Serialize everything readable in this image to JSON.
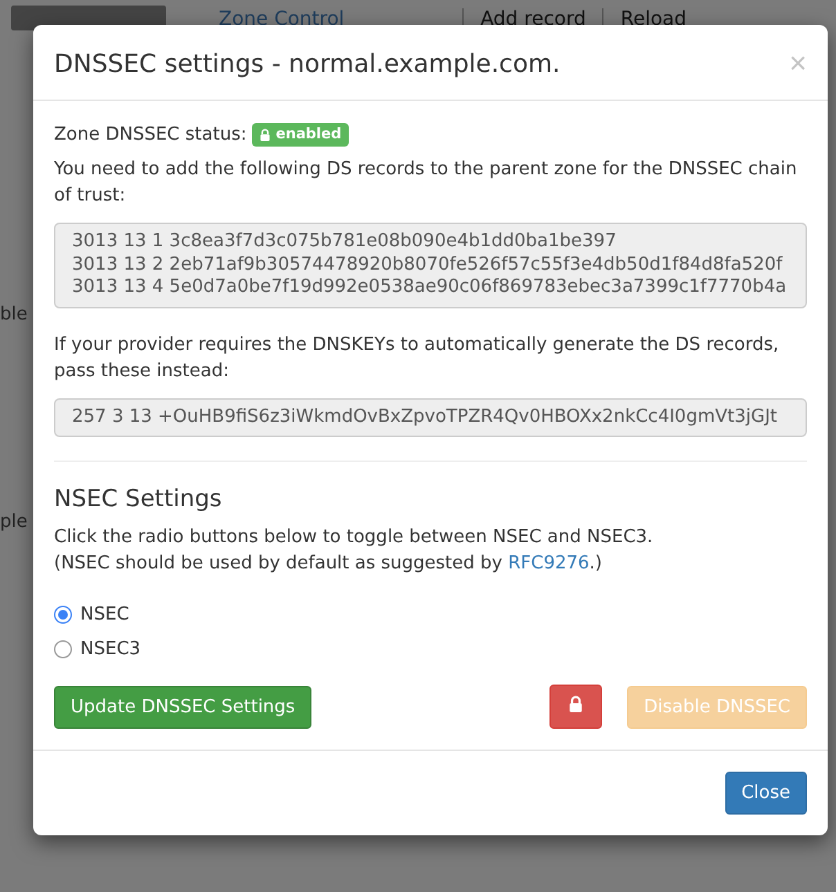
{
  "background": {
    "nav_link": "Zone Control",
    "toolbar": [
      "Add record",
      "Reload"
    ],
    "fragments": [
      "ble",
      "ple"
    ]
  },
  "modal": {
    "title": "DNSSEC settings - normal.example.com.",
    "close_symbol": "×",
    "status_label": "Zone DNSSEC status:",
    "status_badge": {
      "text": "enabled",
      "enabled": true
    },
    "ds_intro": "You need to add the following DS records to the parent zone for the DNSSEC chain of trust:",
    "ds_records": [
      "3013 13 1 3c8ea3f7d3c075b781e08b090e4b1dd0ba1be397",
      "3013 13 2 2eb71af9b30574478920b8070fe526f57c55f3e4db50d1f84d8fa520f",
      "3013 13 4 5e0d7a0be7f19d992e0538ae90c06f869783ebec3a7399c1f7770b4a"
    ],
    "dnskey_intro": "If your provider requires the DNSKEYs to automatically generate the DS records, pass these instead:",
    "dnskeys": [
      "257 3 13 +OuHB9fiS6z3iWkmdOvBxZpvoTPZR4Qv0HBOXx2nkCc4I0gmVt3jGJt"
    ],
    "nsec_heading": "NSEC Settings",
    "nsec_help": [
      "Click the radio buttons below to toggle between NSEC and NSEC3.",
      {
        "before": "(NSEC should be used by default as suggested by ",
        "link": "RFC9276",
        "after": ".)"
      }
    ],
    "nsec_options": [
      {
        "label": "NSEC",
        "selected": true
      },
      {
        "label": "NSEC3",
        "selected": false
      }
    ],
    "update_button": "Update DNSSEC Settings",
    "disable_button": {
      "text": "Disable DNSSEC",
      "disabled": true
    },
    "footer_button": "Close"
  }
}
